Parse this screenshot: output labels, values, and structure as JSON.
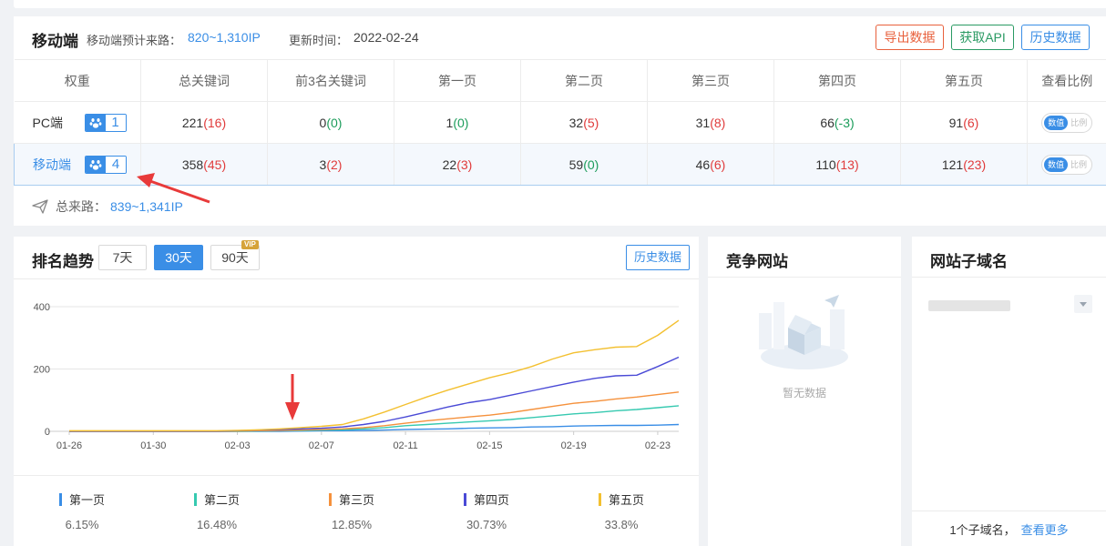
{
  "mobile_panel": {
    "title": "移动端",
    "est_label": "移动端预计来路：",
    "est_value": "820~1,310IP",
    "update_label": "更新时间：",
    "update_value": "2022-02-24",
    "buttons": {
      "export": "导出数据",
      "api": "获取API",
      "history": "历史数据"
    },
    "table": {
      "headers": [
        "权重",
        "总关键词",
        "前3名关键词",
        "第一页",
        "第二页",
        "第三页",
        "第四页",
        "第五页",
        "查看比例"
      ],
      "rows": [
        {
          "label": "PC端",
          "weight": "1",
          "cells": [
            {
              "v": "221",
              "d": "(16)",
              "c": "red"
            },
            {
              "v": "0",
              "d": "(0)",
              "c": "green"
            },
            {
              "v": "1",
              "d": "(0)",
              "c": "green"
            },
            {
              "v": "32",
              "d": "(5)",
              "c": "red"
            },
            {
              "v": "31",
              "d": "(8)",
              "c": "red"
            },
            {
              "v": "66",
              "d": "(-3)",
              "c": "green"
            },
            {
              "v": "91",
              "d": "(6)",
              "c": "red"
            }
          ]
        },
        {
          "label": "移动端",
          "weight": "4",
          "cells": [
            {
              "v": "358",
              "d": "(45)",
              "c": "red"
            },
            {
              "v": "3",
              "d": "(2)",
              "c": "red"
            },
            {
              "v": "22",
              "d": "(3)",
              "c": "red"
            },
            {
              "v": "59",
              "d": "(0)",
              "c": "green"
            },
            {
              "v": "46",
              "d": "(6)",
              "c": "red"
            },
            {
              "v": "110",
              "d": "(13)",
              "c": "red"
            },
            {
              "v": "121",
              "d": "(23)",
              "c": "red"
            }
          ]
        }
      ],
      "toggle": {
        "on": "数值",
        "off": "比例"
      }
    },
    "total_label": "总来路：",
    "total_value": "839~1,341IP"
  },
  "trend_panel": {
    "title": "排名趋势",
    "ranges": [
      "7天",
      "30天",
      "90天"
    ],
    "active_range": "30天",
    "vip_badge": "VIP",
    "history_button": "历史数据",
    "legend": [
      {
        "name": "第一页",
        "pct": "6.15%",
        "color": "#3a8ee6"
      },
      {
        "name": "第二页",
        "pct": "16.48%",
        "color": "#36c9b0"
      },
      {
        "name": "第三页",
        "pct": "12.85%",
        "color": "#f5913c"
      },
      {
        "name": "第四页",
        "pct": "30.73%",
        "color": "#4a4ad6"
      },
      {
        "name": "第五页",
        "pct": "33.8%",
        "color": "#f3c030"
      }
    ]
  },
  "chart_data": {
    "type": "line",
    "title": "",
    "xlabel": "",
    "ylabel": "",
    "ylim": [
      0,
      400
    ],
    "yticks": [
      0,
      200,
      400
    ],
    "xtick_labels": [
      "01-26",
      "01-30",
      "02-03",
      "02-07",
      "02-11",
      "02-15",
      "02-19",
      "02-23"
    ],
    "x": [
      "01-26",
      "01-27",
      "01-28",
      "01-29",
      "01-30",
      "01-31",
      "02-01",
      "02-02",
      "02-03",
      "02-04",
      "02-05",
      "02-06",
      "02-07",
      "02-08",
      "02-09",
      "02-10",
      "02-11",
      "02-12",
      "02-13",
      "02-14",
      "02-15",
      "02-16",
      "02-17",
      "02-18",
      "02-19",
      "02-20",
      "02-21",
      "02-22",
      "02-23",
      "02-24"
    ],
    "grid": true,
    "series": [
      {
        "name": "第一页",
        "color": "#3a8ee6",
        "values": [
          0,
          0,
          0,
          0,
          0,
          0,
          0,
          0,
          0,
          0,
          0,
          1,
          2,
          2,
          3,
          4,
          6,
          7,
          8,
          10,
          11,
          12,
          14,
          15,
          17,
          18,
          19,
          19,
          20,
          22
        ]
      },
      {
        "name": "第二页",
        "color": "#36c9b0",
        "values": [
          0,
          0,
          0,
          0,
          0,
          0,
          0,
          0,
          0,
          1,
          2,
          3,
          4,
          5,
          8,
          12,
          18,
          22,
          26,
          30,
          34,
          38,
          44,
          50,
          56,
          60,
          66,
          70,
          76,
          82
        ]
      },
      {
        "name": "第三页",
        "color": "#f5913c",
        "values": [
          0,
          0,
          0,
          0,
          0,
          0,
          0,
          0,
          1,
          2,
          3,
          4,
          6,
          8,
          12,
          18,
          26,
          34,
          40,
          46,
          52,
          60,
          70,
          80,
          90,
          96,
          104,
          110,
          118,
          126
        ]
      },
      {
        "name": "第四页",
        "color": "#4a4ad6",
        "values": [
          1,
          1,
          1,
          1,
          1,
          1,
          1,
          1,
          2,
          4,
          6,
          8,
          10,
          14,
          22,
          32,
          46,
          62,
          78,
          92,
          102,
          116,
          130,
          144,
          158,
          170,
          178,
          180,
          208,
          238
        ]
      },
      {
        "name": "第五页",
        "color": "#f3c030",
        "values": [
          2,
          2,
          2,
          2,
          2,
          2,
          2,
          2,
          3,
          5,
          8,
          12,
          16,
          22,
          40,
          62,
          86,
          110,
          132,
          152,
          172,
          188,
          208,
          232,
          252,
          262,
          270,
          272,
          308,
          356
        ]
      }
    ]
  },
  "competitor_panel": {
    "title": "竞争网站",
    "empty_text": "暂无数据"
  },
  "subdomain_panel": {
    "title": "网站子域名",
    "count_text": "1个子域名，",
    "more_link": "查看更多"
  }
}
